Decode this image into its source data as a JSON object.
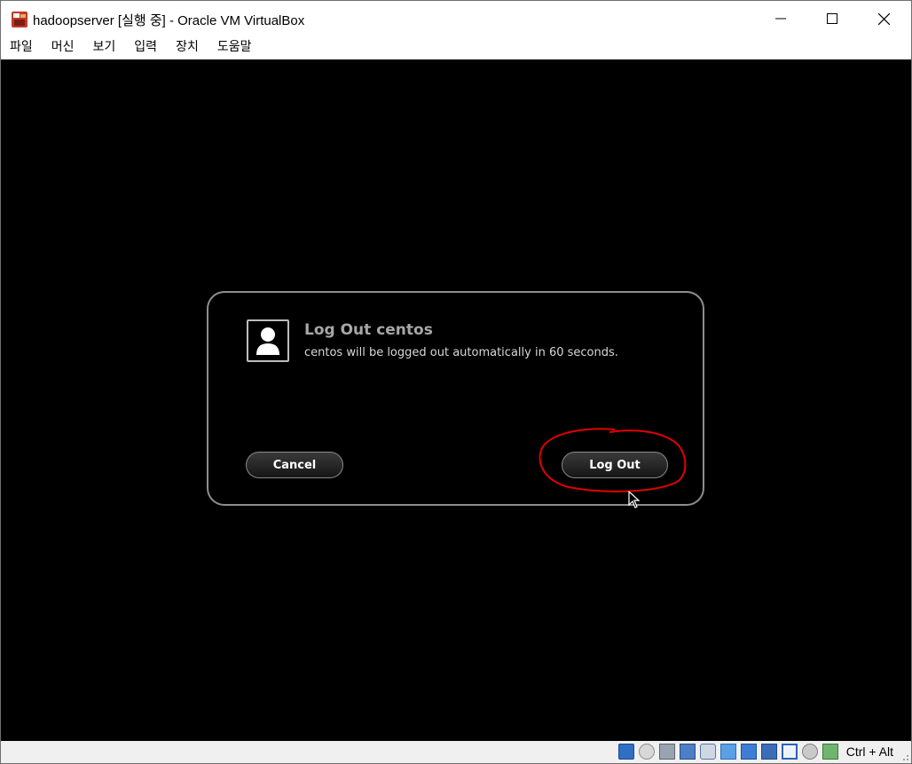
{
  "window": {
    "title": "hadoopserver [실행 중] - Oracle VM VirtualBox"
  },
  "menu": {
    "items": [
      "파일",
      "머신",
      "보기",
      "입력",
      "장치",
      "도움말"
    ]
  },
  "dialog": {
    "title": "Log Out centos",
    "message": "centos will be logged out automatically in 60 seconds.",
    "cancel_label": "Cancel",
    "logout_label": "Log Out"
  },
  "statusbar": {
    "icons": [
      "hard-disk-icon",
      "optical-drive-icon",
      "audio-icon",
      "network-icon",
      "usb-icon",
      "shared-folders-icon",
      "display-icon",
      "video-capture-icon",
      "cpu-icon",
      "mouse-integration-icon",
      "keyboard-capture-icon"
    ],
    "host_key": "Ctrl + Alt"
  },
  "colors": {
    "vm_background": "#000000",
    "dialog_border": "#8e8e8e",
    "annotation": "#e00000"
  }
}
